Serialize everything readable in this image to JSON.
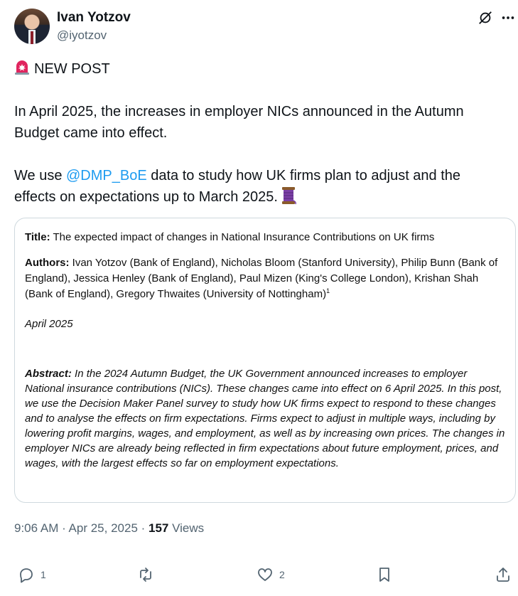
{
  "author": {
    "name": "Ivan Yotzov",
    "handle": "@iyotzov"
  },
  "header_icons": [
    "grok-icon",
    "more-icon"
  ],
  "tweet": {
    "line1": "NEW POST",
    "para2": "In April 2025, the increases in employer NICs announced in the Autumn Budget came into effect.",
    "para3_pre": "We use ",
    "mention": "@DMP_BoE",
    "para3_post": " data to study how UK firms plan to adjust and the effects on expectations up to March 2025."
  },
  "paper": {
    "title_label": "Title:",
    "title": "The expected impact of changes in National Insurance Contributions on UK firms",
    "authors_label": "Authors:",
    "authors": "Ivan Yotzov (Bank of England), Nicholas Bloom (Stanford University), Philip Bunn (Bank of England), Jessica Henley (Bank of England), Paul Mizen (King's College London), Krishan Shah (Bank of England), Gregory Thwaites (University of Nottingham)",
    "authors_footnote": "1",
    "date": "April 2025",
    "abstract_label": "Abstract:",
    "abstract": "In the 2024 Autumn Budget, the UK Government announced increases to employer National insurance contributions (NICs). These changes came into effect on 6 April 2025. In this post, we use the Decision Maker Panel survey to study how UK firms expect to respond to these changes and to analyse the effects on firm expectations. Firms expect to adjust in multiple ways, including by lowering profit margins, wages, and employment, as well as by increasing own prices. The changes in employer NICs are already being reflected in firm expectations about future employment, prices, and wages, with the largest effects so far on employment expectations."
  },
  "meta": {
    "time": "9:06 AM",
    "sep": " · ",
    "date": "Apr 25, 2025",
    "views_count": "157",
    "views_label": " Views"
  },
  "actions": {
    "replies": "1",
    "reposts": "",
    "likes": "2"
  },
  "colors": {
    "accent": "#1d9bf0",
    "muted": "#536471",
    "text": "#0f1419",
    "border": "#cfd9de"
  }
}
